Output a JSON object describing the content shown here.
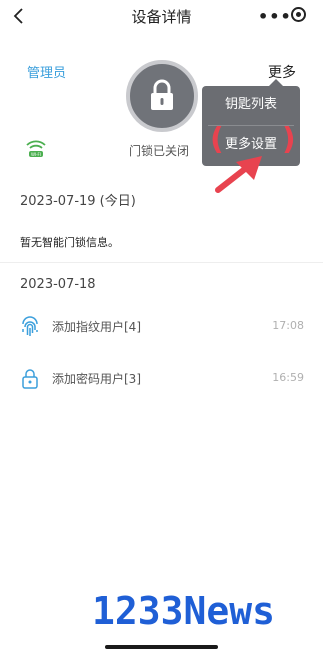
{
  "nav": {
    "title": "设备详情",
    "more_dots": "•••"
  },
  "header": {
    "admin_label": "管理员",
    "more_label": "更多"
  },
  "lock": {
    "status_text": "门锁已关闭"
  },
  "menu": {
    "items": [
      {
        "label": "钥匙列表"
      },
      {
        "label": "更多设置"
      }
    ]
  },
  "annotation": {
    "color": "#e8434f"
  },
  "log": {
    "sections": [
      {
        "date": "2023-07-19 (今日)",
        "notice": "暂无智能门锁信息。"
      },
      {
        "date": "2023-07-18",
        "records": [
          {
            "text": "添加指纹用户[4]",
            "time": "17:08",
            "icon": "fingerprint-icon"
          },
          {
            "text": "添加密码用户[3]",
            "time": "16:59",
            "icon": "password-lock-icon"
          }
        ]
      }
    ]
  },
  "watermark": {
    "text": "1233News",
    "color": "#1f5fd6"
  },
  "colors": {
    "accent": "#3b9fdc",
    "wifi": "#4caf50",
    "menu_bg": "#6b6d72"
  }
}
